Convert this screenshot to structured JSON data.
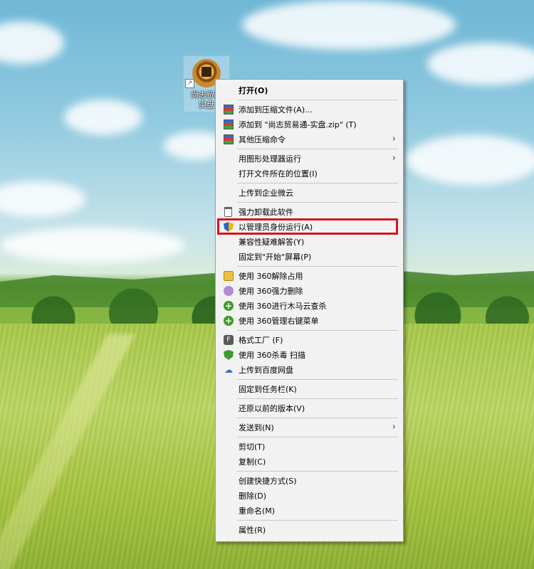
{
  "desktop_icon": {
    "label": "尚志贸易\n实盘"
  },
  "highlight_color": "#d8141c",
  "menu": {
    "items": [
      {
        "label": "打开(O)",
        "bold": true,
        "icon": ""
      },
      {
        "sep": true
      },
      {
        "label": "添加到压缩文件(A)...",
        "icon": "archive-icon"
      },
      {
        "label": "添加到 \"尚志贸易通-实盘.zip\" (T)",
        "icon": "archive-icon"
      },
      {
        "label": "其他压缩命令",
        "icon": "archive-icon",
        "submenu": true
      },
      {
        "sep": true
      },
      {
        "label": "用图形处理器运行",
        "icon": "",
        "submenu": true
      },
      {
        "label": "打开文件所在的位置(I)",
        "icon": ""
      },
      {
        "sep": true
      },
      {
        "label": "上传到企业微云",
        "icon": ""
      },
      {
        "sep": true
      },
      {
        "label": "强力卸载此软件",
        "icon": "trash-icon"
      },
      {
        "label": "以管理员身份运行(A)",
        "icon": "uac-shield-icon",
        "highlighted": true
      },
      {
        "label": "兼容性疑难解答(Y)",
        "icon": ""
      },
      {
        "label": "固定到\"开始\"屏幕(P)",
        "icon": ""
      },
      {
        "sep": true
      },
      {
        "label": "使用 360解除占用",
        "icon": "360-unlock-icon"
      },
      {
        "label": "使用 360强力删除",
        "icon": "360-delete-icon"
      },
      {
        "label": "使用 360进行木马云查杀",
        "icon": "360-scan-icon"
      },
      {
        "label": "使用 360管理右键菜单",
        "icon": "360-menu-icon"
      },
      {
        "sep": true
      },
      {
        "label": "格式工厂 (F)",
        "icon": "format-factory-icon"
      },
      {
        "label": "使用 360杀毒 扫描",
        "icon": "360-antivirus-icon"
      },
      {
        "label": "上传到百度网盘",
        "icon": "baidu-cloud-icon"
      },
      {
        "sep": true
      },
      {
        "label": "固定到任务栏(K)",
        "icon": ""
      },
      {
        "sep": true
      },
      {
        "label": "还原以前的版本(V)",
        "icon": ""
      },
      {
        "sep": true
      },
      {
        "label": "发送到(N)",
        "icon": "",
        "submenu": true
      },
      {
        "sep": true
      },
      {
        "label": "剪切(T)",
        "icon": ""
      },
      {
        "label": "复制(C)",
        "icon": ""
      },
      {
        "sep": true
      },
      {
        "label": "创建快捷方式(S)",
        "icon": ""
      },
      {
        "label": "删除(D)",
        "icon": ""
      },
      {
        "label": "重命名(M)",
        "icon": ""
      },
      {
        "sep": true
      },
      {
        "label": "属性(R)",
        "icon": ""
      }
    ]
  }
}
